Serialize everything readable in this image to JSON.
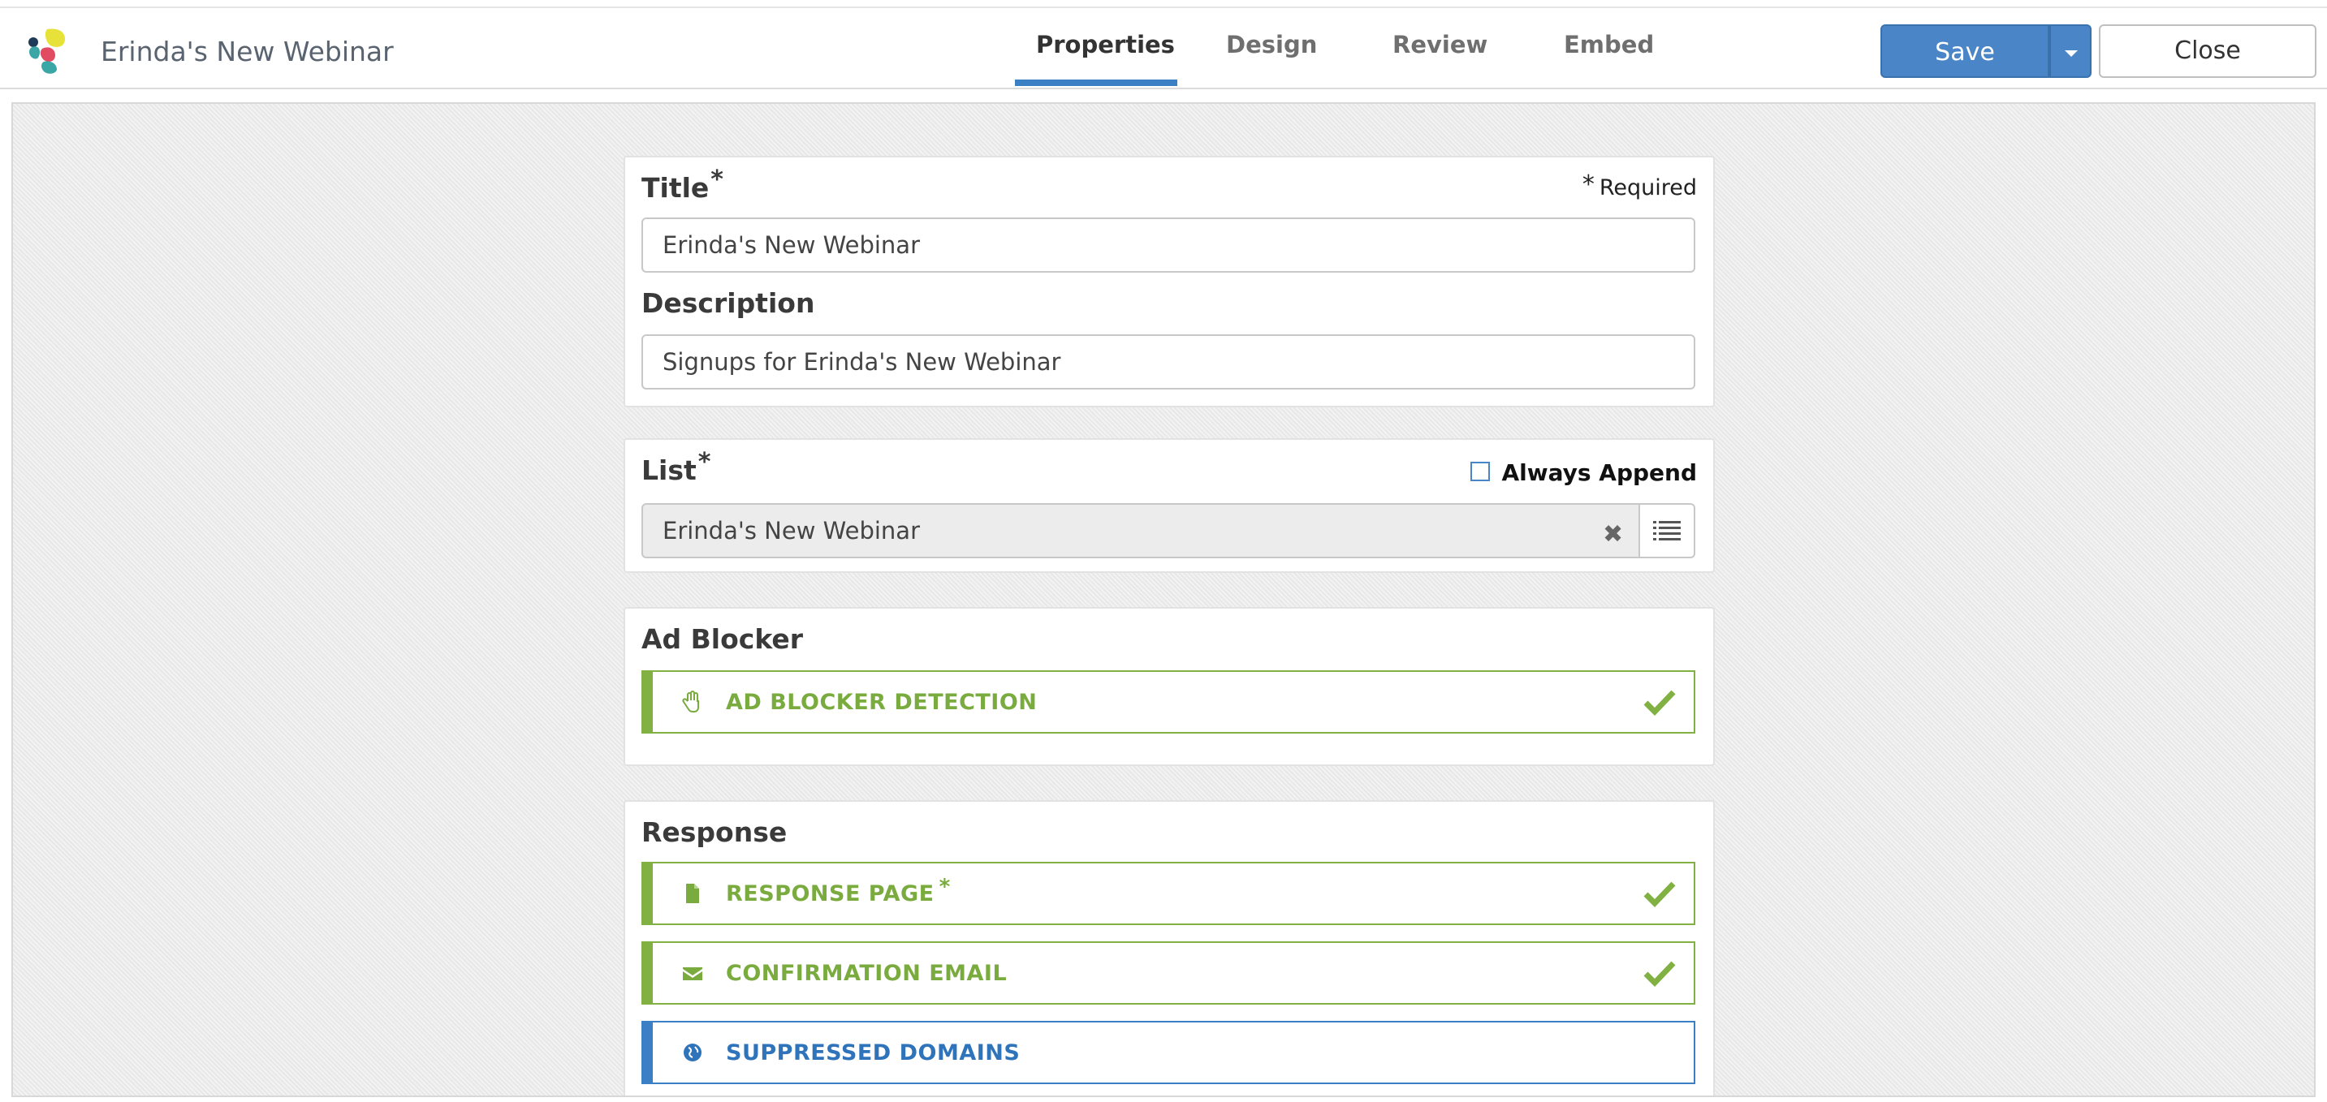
{
  "app": {
    "title": "Erinda's New Webinar",
    "logo_icon": "app-logo-icon"
  },
  "tabs": [
    {
      "label": "Properties",
      "active": true
    },
    {
      "label": "Design",
      "active": false
    },
    {
      "label": "Review",
      "active": false
    },
    {
      "label": "Embed",
      "active": false
    }
  ],
  "actions": {
    "save_label": "Save",
    "close_label": "Close"
  },
  "colors": {
    "accent_blue": "#4a86c7",
    "success_green": "#80b142",
    "link_blue": "#2f74bb"
  },
  "properties": {
    "title_label": "Title",
    "asterisk": "*",
    "required_note": "Required",
    "title_value": "Erinda's New Webinar",
    "description_label": "Description",
    "description_value": "Signups for Erinda's New Webinar"
  },
  "list": {
    "label": "List",
    "always_append_label": "Always Append",
    "always_append_checked": false,
    "selected": "Erinda's New Webinar",
    "clear_icon": "close-icon",
    "browse_icon": "list-icon"
  },
  "ad_blocker": {
    "heading": "Ad Blocker",
    "items": [
      {
        "label": "AD BLOCKER DETECTION",
        "icon": "hand-icon",
        "status": "complete"
      }
    ]
  },
  "response": {
    "heading": "Response",
    "items": [
      {
        "label": "RESPONSE PAGE",
        "required_mark": "*",
        "icon": "file-icon",
        "status": "complete"
      },
      {
        "label": "CONFIRMATION EMAIL",
        "icon": "envelope-icon",
        "status": "complete"
      },
      {
        "label": "SUPPRESSED DOMAINS",
        "icon": "globe-icon",
        "status": "incomplete"
      }
    ]
  }
}
